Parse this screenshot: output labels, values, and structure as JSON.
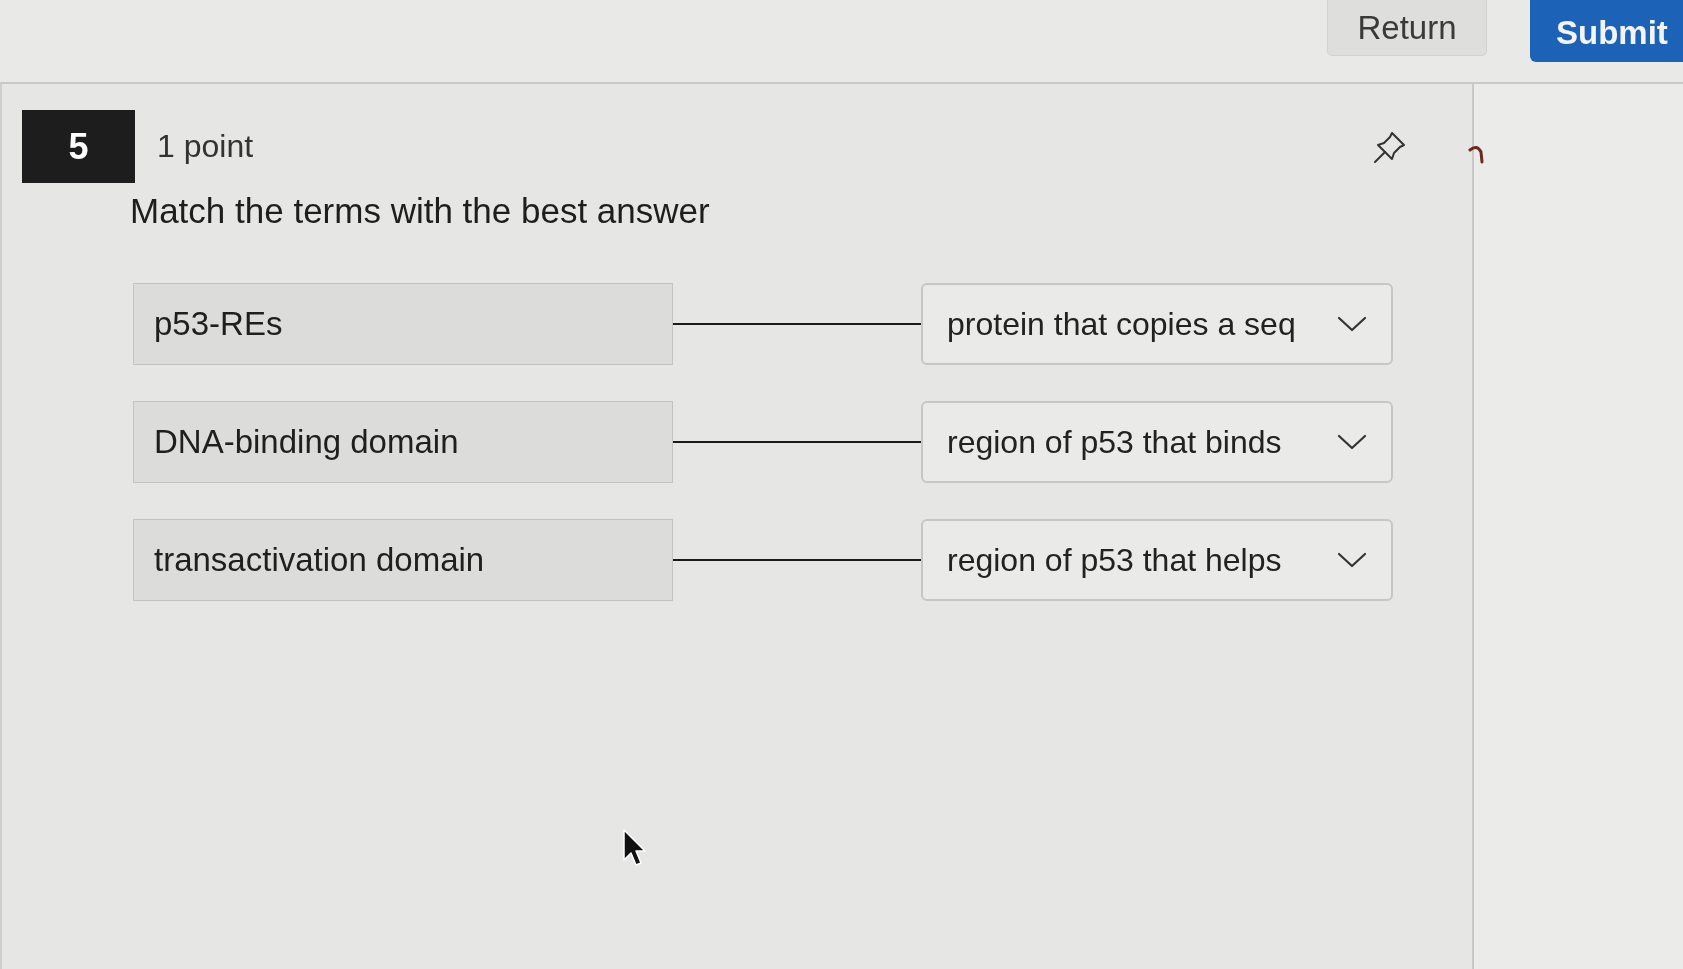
{
  "header": {
    "buttons": [
      {
        "label": "Return",
        "kind": "secondary"
      },
      {
        "label": "Submit",
        "kind": "primary"
      }
    ]
  },
  "question": {
    "number": "5",
    "points": "1 point",
    "prompt": "Match the terms with the best answer",
    "matches": [
      {
        "term": "p53-REs",
        "answer": "protein that copies a seq"
      },
      {
        "term": "DNA-binding domain",
        "answer": "region of p53 that binds"
      },
      {
        "term": "transactivation domain",
        "answer": "region of p53 that helps"
      }
    ]
  }
}
